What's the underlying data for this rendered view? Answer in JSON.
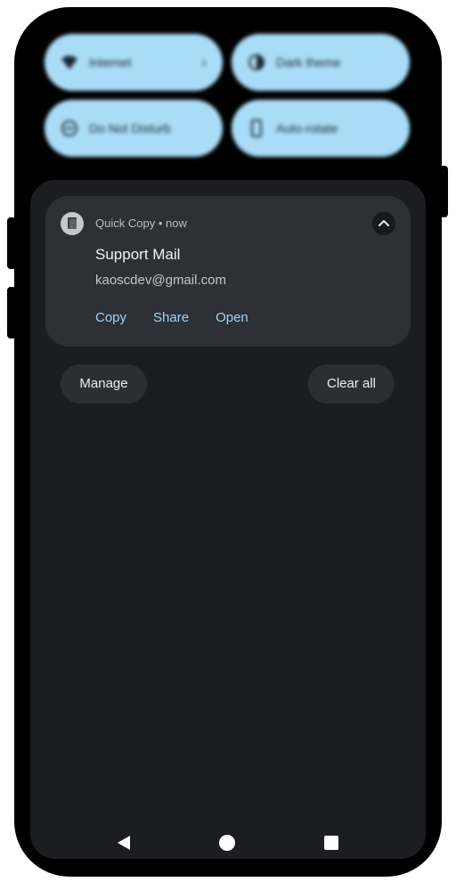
{
  "quick_settings": {
    "tiles": [
      {
        "label": "Internet",
        "icon": "wifi-icon",
        "has_chevron": true
      },
      {
        "label": "Dark theme",
        "icon": "dark-theme-icon"
      },
      {
        "label": "Do Not Disturb",
        "icon": "do-not-disturb-icon"
      },
      {
        "label": "Auto-rotate",
        "icon": "auto-rotate-icon"
      }
    ],
    "tile_color": "#a9dcf7"
  },
  "notification": {
    "app_name": "Quick Copy",
    "separator": "•",
    "time": "now",
    "app_icon": "copy-icon",
    "title": "Support Mail",
    "body": "kaoscdev@gmail.com",
    "actions": [
      "Copy",
      "Share",
      "Open"
    ],
    "action_color": "#9ed4f5"
  },
  "footer": {
    "manage_label": "Manage",
    "clear_label": "Clear all"
  },
  "navigation": {
    "back_icon": "back-triangle-icon",
    "home_icon": "home-circle-icon",
    "recents_icon": "recents-square-icon"
  }
}
